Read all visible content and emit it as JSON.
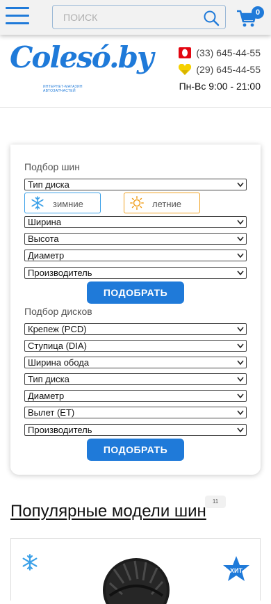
{
  "topbar": {
    "search_placeholder": "ПОИСК",
    "cart_count": "0"
  },
  "header": {
    "logo_text": "Colesó.by",
    "logo_subtitle": "ИНТЕРНЕТ-МАГАЗИН АВТОЗАПЧАСТЕЙ",
    "phones": [
      {
        "operator": "mts",
        "number": "(33) 645-44-55"
      },
      {
        "operator": "a1",
        "number": "(29) 645-44-55"
      }
    ],
    "hours": "Пн-Вс 9:00 - 21:00"
  },
  "tires": {
    "title": "Подбор шин",
    "disc_type": "Тип диска",
    "winter_label": "зимние",
    "summer_label": "летние",
    "width": "Ширина",
    "height": "Высота",
    "diameter": "Диаметр",
    "manufacturer": "Производитель",
    "button": "ПОДОБРАТЬ"
  },
  "discs": {
    "title": "Подбор дисков",
    "pcd": "Крепеж (PCD)",
    "dia": "Ступица (DIA)",
    "rim_width": "Ширина обода",
    "disc_type": "Тип диска",
    "diameter": "Диаметр",
    "et": "Вылет (ET)",
    "manufacturer": "Производитель",
    "button": "ПОДОБРАТЬ"
  },
  "popular": {
    "title": "Популярные модели шин",
    "count": "11",
    "badge": "ХИТ"
  },
  "colors": {
    "accent": "#1f7ad9",
    "winter": "#3aa0e8",
    "summer": "#f0a020",
    "mts": "#e30611",
    "a1": "#f5d000"
  }
}
